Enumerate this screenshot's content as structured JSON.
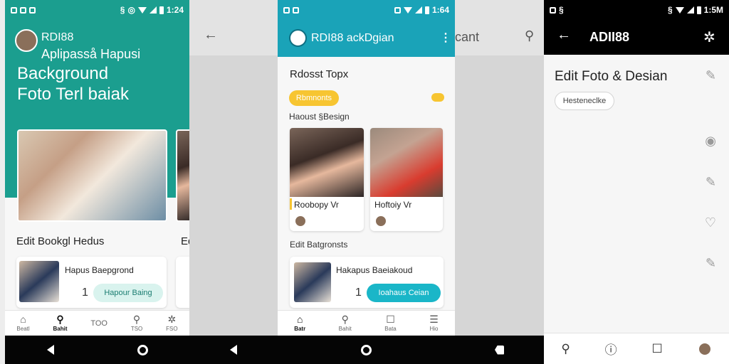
{
  "phone1": {
    "status_time": "1:24",
    "app_name": "RDI88",
    "header_sub": "Aplipasså Hapusi",
    "hero_line1": "Background",
    "hero_line2": "Foto Terl baiak",
    "section_title": "Edit Bookgl Hedus",
    "section_peek": "Ed",
    "card_title": "Hapus Baepgrond",
    "card_count": "1",
    "card_button": "Hapour Baing",
    "tabs": [
      {
        "label": "Beatl",
        "icon": "home-icon"
      },
      {
        "label": "Bahit",
        "icon": "search-icon"
      },
      {
        "label": "TOO",
        "icon": "none"
      },
      {
        "label": "TSO",
        "icon": "search-icon"
      },
      {
        "label": "FSO",
        "icon": "settings-icon"
      }
    ],
    "colors": {
      "header": "#1b9e8f",
      "accent": "#d9f3ee"
    }
  },
  "gap1": {
    "back_glyph": "←"
  },
  "phone2": {
    "status_time": "1:64",
    "app_title": "RDI88 ackDgian",
    "section1": "Rdosst Topx",
    "chip": "Rbmnonts",
    "sub_label": "Haoust §Besign",
    "card1_title": "Roobopy Vr",
    "card2_title": "Hoftoiy Vr",
    "section2": "Edit Batgronsts",
    "list_title": "Hakapus Baeiakoud",
    "list_count": "1",
    "list_button": "Ioahaus Ceian",
    "tabs": [
      {
        "label": "Batr",
        "icon": "home-icon"
      },
      {
        "label": "Bahit",
        "icon": "search-icon"
      },
      {
        "label": "Bata",
        "icon": "chat-icon"
      },
      {
        "label": "Hio",
        "icon": "menu-icon"
      }
    ],
    "colors": {
      "header": "#1aa3b8",
      "chip": "#f7c531",
      "button": "#1ab6c8"
    }
  },
  "gap2": {
    "partial_text": "cant"
  },
  "phone3": {
    "status_time": "1:5M",
    "title": "ADII88",
    "heading": "Edit Foto & Desian",
    "chip": "Hesteneclke",
    "colors": {
      "header": "#000000"
    }
  }
}
